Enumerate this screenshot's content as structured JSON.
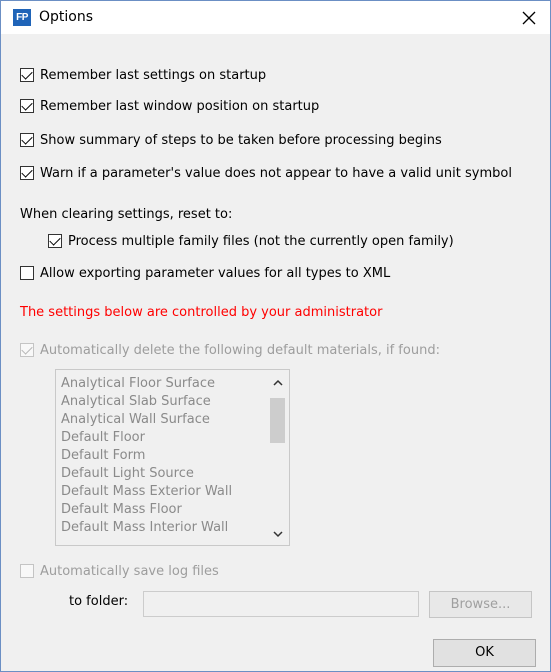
{
  "window": {
    "title": "Options",
    "app_icon_text": "FP"
  },
  "options": {
    "remember_settings": "Remember last settings on startup",
    "remember_window": "Remember last window position on startup",
    "show_summary": "Show summary of steps to be taken before processing begins",
    "warn_unit": "Warn if a parameter's value does not appear to have a valid unit symbol",
    "reset_heading": "When clearing settings, reset to:",
    "process_multiple": "Process multiple family files (not the currently open family)",
    "allow_export": "Allow exporting parameter values for all types to XML"
  },
  "admin": {
    "note": "The settings below are controlled by your administrator",
    "auto_delete": "Automatically delete the following default materials, if found:",
    "materials": [
      "Analytical Floor Surface",
      "Analytical Slab Surface",
      "Analytical Wall Surface",
      "Default Floor",
      "Default Form",
      "Default Light Source",
      "Default Mass Exterior Wall",
      "Default Mass Floor",
      "Default Mass Interior Wall"
    ],
    "auto_save_log": "Automatically save log files",
    "folder_label": "to folder:",
    "folder_value": "",
    "browse_label": "Browse..."
  },
  "buttons": {
    "ok": "OK"
  },
  "colors": {
    "admin_note": "#ff0000",
    "app_icon": "#1f64b8"
  }
}
